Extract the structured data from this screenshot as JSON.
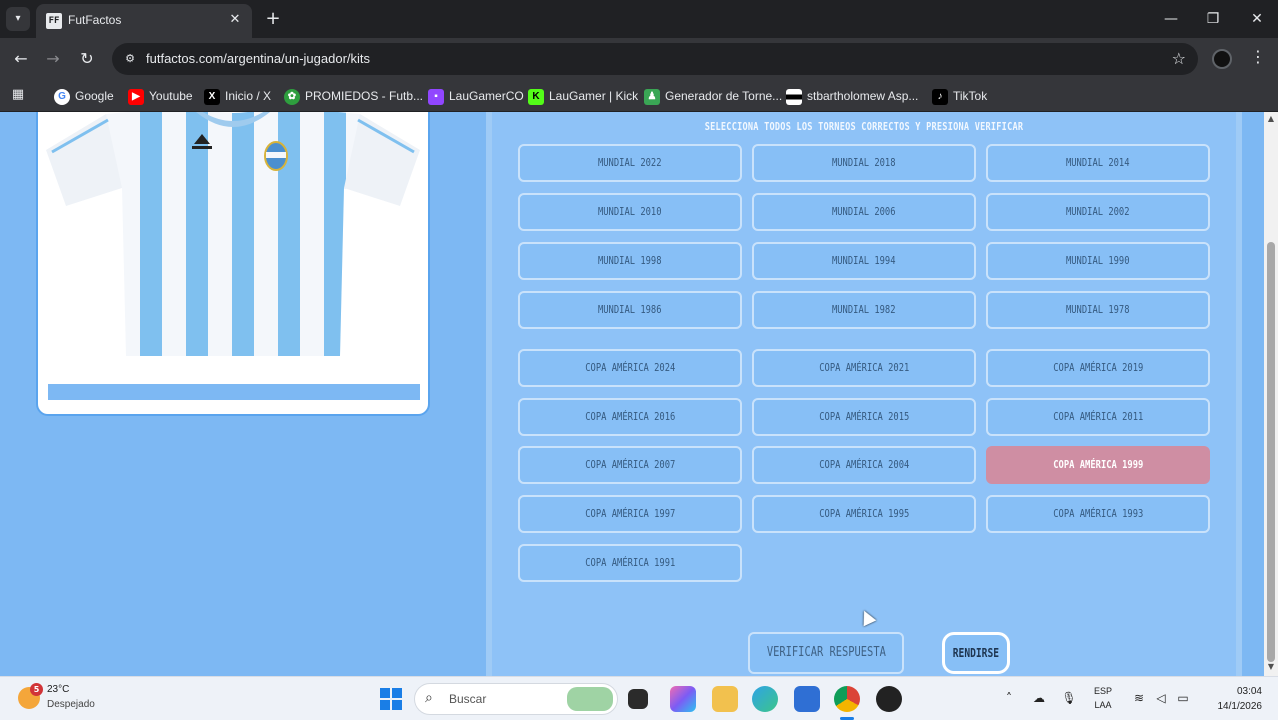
{
  "browser": {
    "tab_title": "FutFactos",
    "favicon_text": "FF",
    "url": "futfactos.com/argentina/un-jugador/kits",
    "bookmarks": [
      {
        "label": "Google",
        "icon": "google-icon",
        "color": "#ffffff"
      },
      {
        "label": "Youtube",
        "icon": "youtube-icon",
        "color": "#ff0000"
      },
      {
        "label": "Inicio / X",
        "icon": "x-icon",
        "color": "#000000"
      },
      {
        "label": "PROMIEDOS - Futb...",
        "icon": "promiedos-icon",
        "color": "#2e9e3e"
      },
      {
        "label": "LauGamerCO",
        "icon": "twitch-icon",
        "color": "#9146ff"
      },
      {
        "label": "LauGamer | Kick",
        "icon": "kick-icon",
        "color": "#53fc18"
      },
      {
        "label": "Generador de Torne...",
        "icon": "generator-icon",
        "color": "#3aa655"
      },
      {
        "label": "stbartholomew Asp...",
        "icon": "flag-icon",
        "color": "#ffffff"
      },
      {
        "label": "TikTok",
        "icon": "tiktok-icon",
        "color": "#000000"
      }
    ]
  },
  "page": {
    "instruction": "SELECCIONA TODOS LOS TORNEOS CORRECTOS Y PRESIONA VERIFICAR",
    "tournaments": [
      {
        "label": "MUNDIAL 2022",
        "selected": false
      },
      {
        "label": "MUNDIAL 2018",
        "selected": false
      },
      {
        "label": "MUNDIAL 2014",
        "selected": false
      },
      {
        "label": "MUNDIAL 2010",
        "selected": false
      },
      {
        "label": "MUNDIAL 2006",
        "selected": false
      },
      {
        "label": "MUNDIAL 2002",
        "selected": false
      },
      {
        "label": "MUNDIAL 1998",
        "selected": false
      },
      {
        "label": "MUNDIAL 1994",
        "selected": false
      },
      {
        "label": "MUNDIAL 1990",
        "selected": false
      },
      {
        "label": "MUNDIAL 1986",
        "selected": false
      },
      {
        "label": "MUNDIAL 1982",
        "selected": false
      },
      {
        "label": "MUNDIAL 1978",
        "selected": false
      },
      {
        "label": "COPA AMÉRICA 2024",
        "selected": false
      },
      {
        "label": "COPA AMÉRICA 2021",
        "selected": false
      },
      {
        "label": "COPA AMÉRICA 2019",
        "selected": false
      },
      {
        "label": "COPA AMÉRICA 2016",
        "selected": false
      },
      {
        "label": "COPA AMÉRICA 2015",
        "selected": false
      },
      {
        "label": "COPA AMÉRICA 2011",
        "selected": false
      },
      {
        "label": "COPA AMÉRICA 2007",
        "selected": false
      },
      {
        "label": "COPA AMÉRICA 2004",
        "selected": false
      },
      {
        "label": "COPA AMÉRICA 1999",
        "selected": true
      },
      {
        "label": "COPA AMÉRICA 1997",
        "selected": false
      },
      {
        "label": "COPA AMÉRICA 1995",
        "selected": false
      },
      {
        "label": "COPA AMÉRICA 1993",
        "selected": false
      },
      {
        "label": "COPA AMÉRICA 1991",
        "selected": false
      }
    ],
    "verify_label": "VERIFICAR RESPUESTA",
    "give_up_label": "RENDIRSE"
  },
  "taskbar": {
    "weather_badge": "5",
    "temperature": "23°C",
    "weather": "Despejado",
    "search_placeholder": "Buscar",
    "lang_top": "ESP",
    "lang_bottom": "LAA",
    "time": "03:04",
    "date": "14/1/2026"
  },
  "colors": {
    "page_bg": "#7db8f3",
    "selected_option": "#cf8ea3",
    "kit_stripe": "#7fc0ef"
  }
}
